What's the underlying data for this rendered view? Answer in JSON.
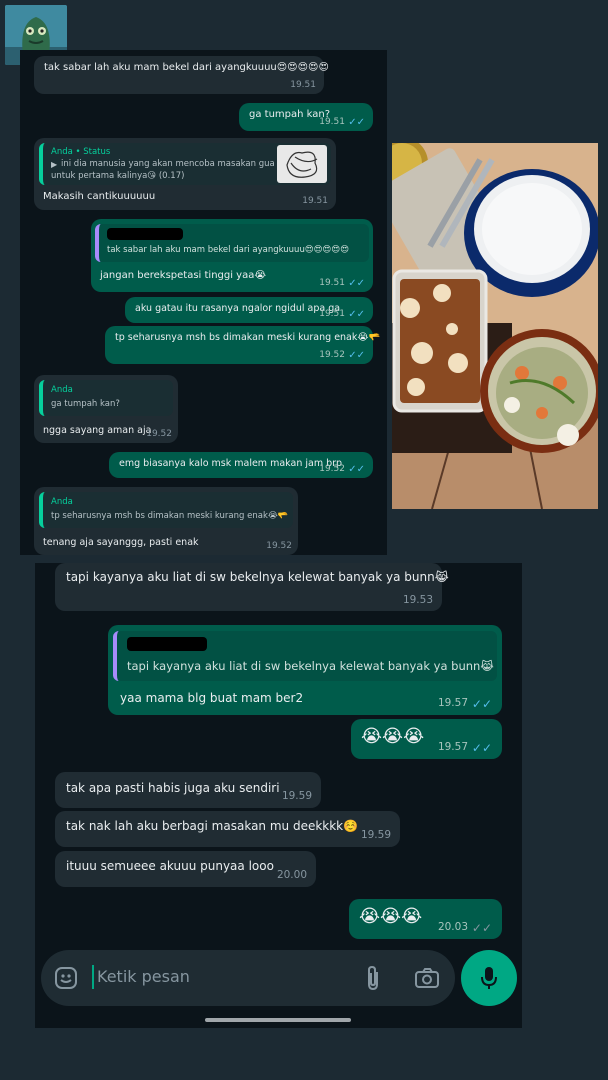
{
  "colors": {
    "page_bg": "#1c2a33",
    "chat_bg": "#0b141a",
    "incoming": "#202c33",
    "outgoing": "#005c4b",
    "tick_read": "#53bdeb",
    "tick_grey": "#8696a0",
    "accent": "#00a884"
  },
  "screen1": {
    "m1": {
      "text": "tak sabar lah aku mam bekel dari ayangkuuuu😍😍😍😍😍",
      "time": "19.51"
    },
    "m2": {
      "text": "ga tumpah kan?",
      "time": "19.51"
    },
    "m3": {
      "quote_author": "Anda • Status",
      "quote_text_1": "ini dia manusia yang akan mencoba masakan gua",
      "quote_text_2": "untuk pertama kalinya😘 (0.17)",
      "text": "Makasih cantikuuuuuu",
      "time": "19.51"
    },
    "m4": {
      "quote_text": "tak sabar lah aku mam bekel dari ayangkuuuu😍😍😍😍😍",
      "text": "jangan berekspetasi tinggi yaa😭",
      "time": "19.51"
    },
    "m5": {
      "text": "aku gatau itu rasanya ngalor ngidul apa ga",
      "time": "19.51"
    },
    "m6": {
      "text": "tp seharusnya msh bs dimakan meski kurang enak😭🫳",
      "time": "19.52"
    },
    "m7": {
      "quote_author": "Anda",
      "quote_text": "ga tumpah kan?",
      "text": "ngga sayang aman aja",
      "time": "19.52"
    },
    "m8": {
      "text": "emg biasanya kalo msk malem makan jam brp",
      "time": "19.52"
    },
    "m9": {
      "quote_author": "Anda",
      "quote_text": "tp seharusnya msh bs dimakan meski kurang enak😭🫳",
      "text": "tenang aja sayanggg, pasti enak",
      "time": "19.52"
    }
  },
  "screen2": {
    "m1": {
      "text": "tapi kayanya aku liat di sw bekelnya kelewat banyak ya bunn😹",
      "time": "19.53"
    },
    "m2": {
      "quote_text": "tapi kayanya aku liat di sw bekelnya kelewat banyak ya bunn😹",
      "text": "yaa mama blg buat mam ber2",
      "time": "19.57"
    },
    "m3": {
      "text": "😭😭😭",
      "time": "19.57"
    },
    "m4": {
      "text": "tak apa pasti habis juga aku sendiri",
      "time": "19.59"
    },
    "m5": {
      "text": "tak nak lah aku berbagi masakan mu deekkkk☺️",
      "time": "19.59"
    },
    "m6": {
      "text": "ituuu semueee akuuu punyaa looo",
      "time": "20.00"
    },
    "m7": {
      "text": "😭😭😭",
      "time": "20.03"
    }
  },
  "input": {
    "placeholder": "Ketik pesan"
  },
  "photo": {
    "description_icon": "food-photo"
  }
}
